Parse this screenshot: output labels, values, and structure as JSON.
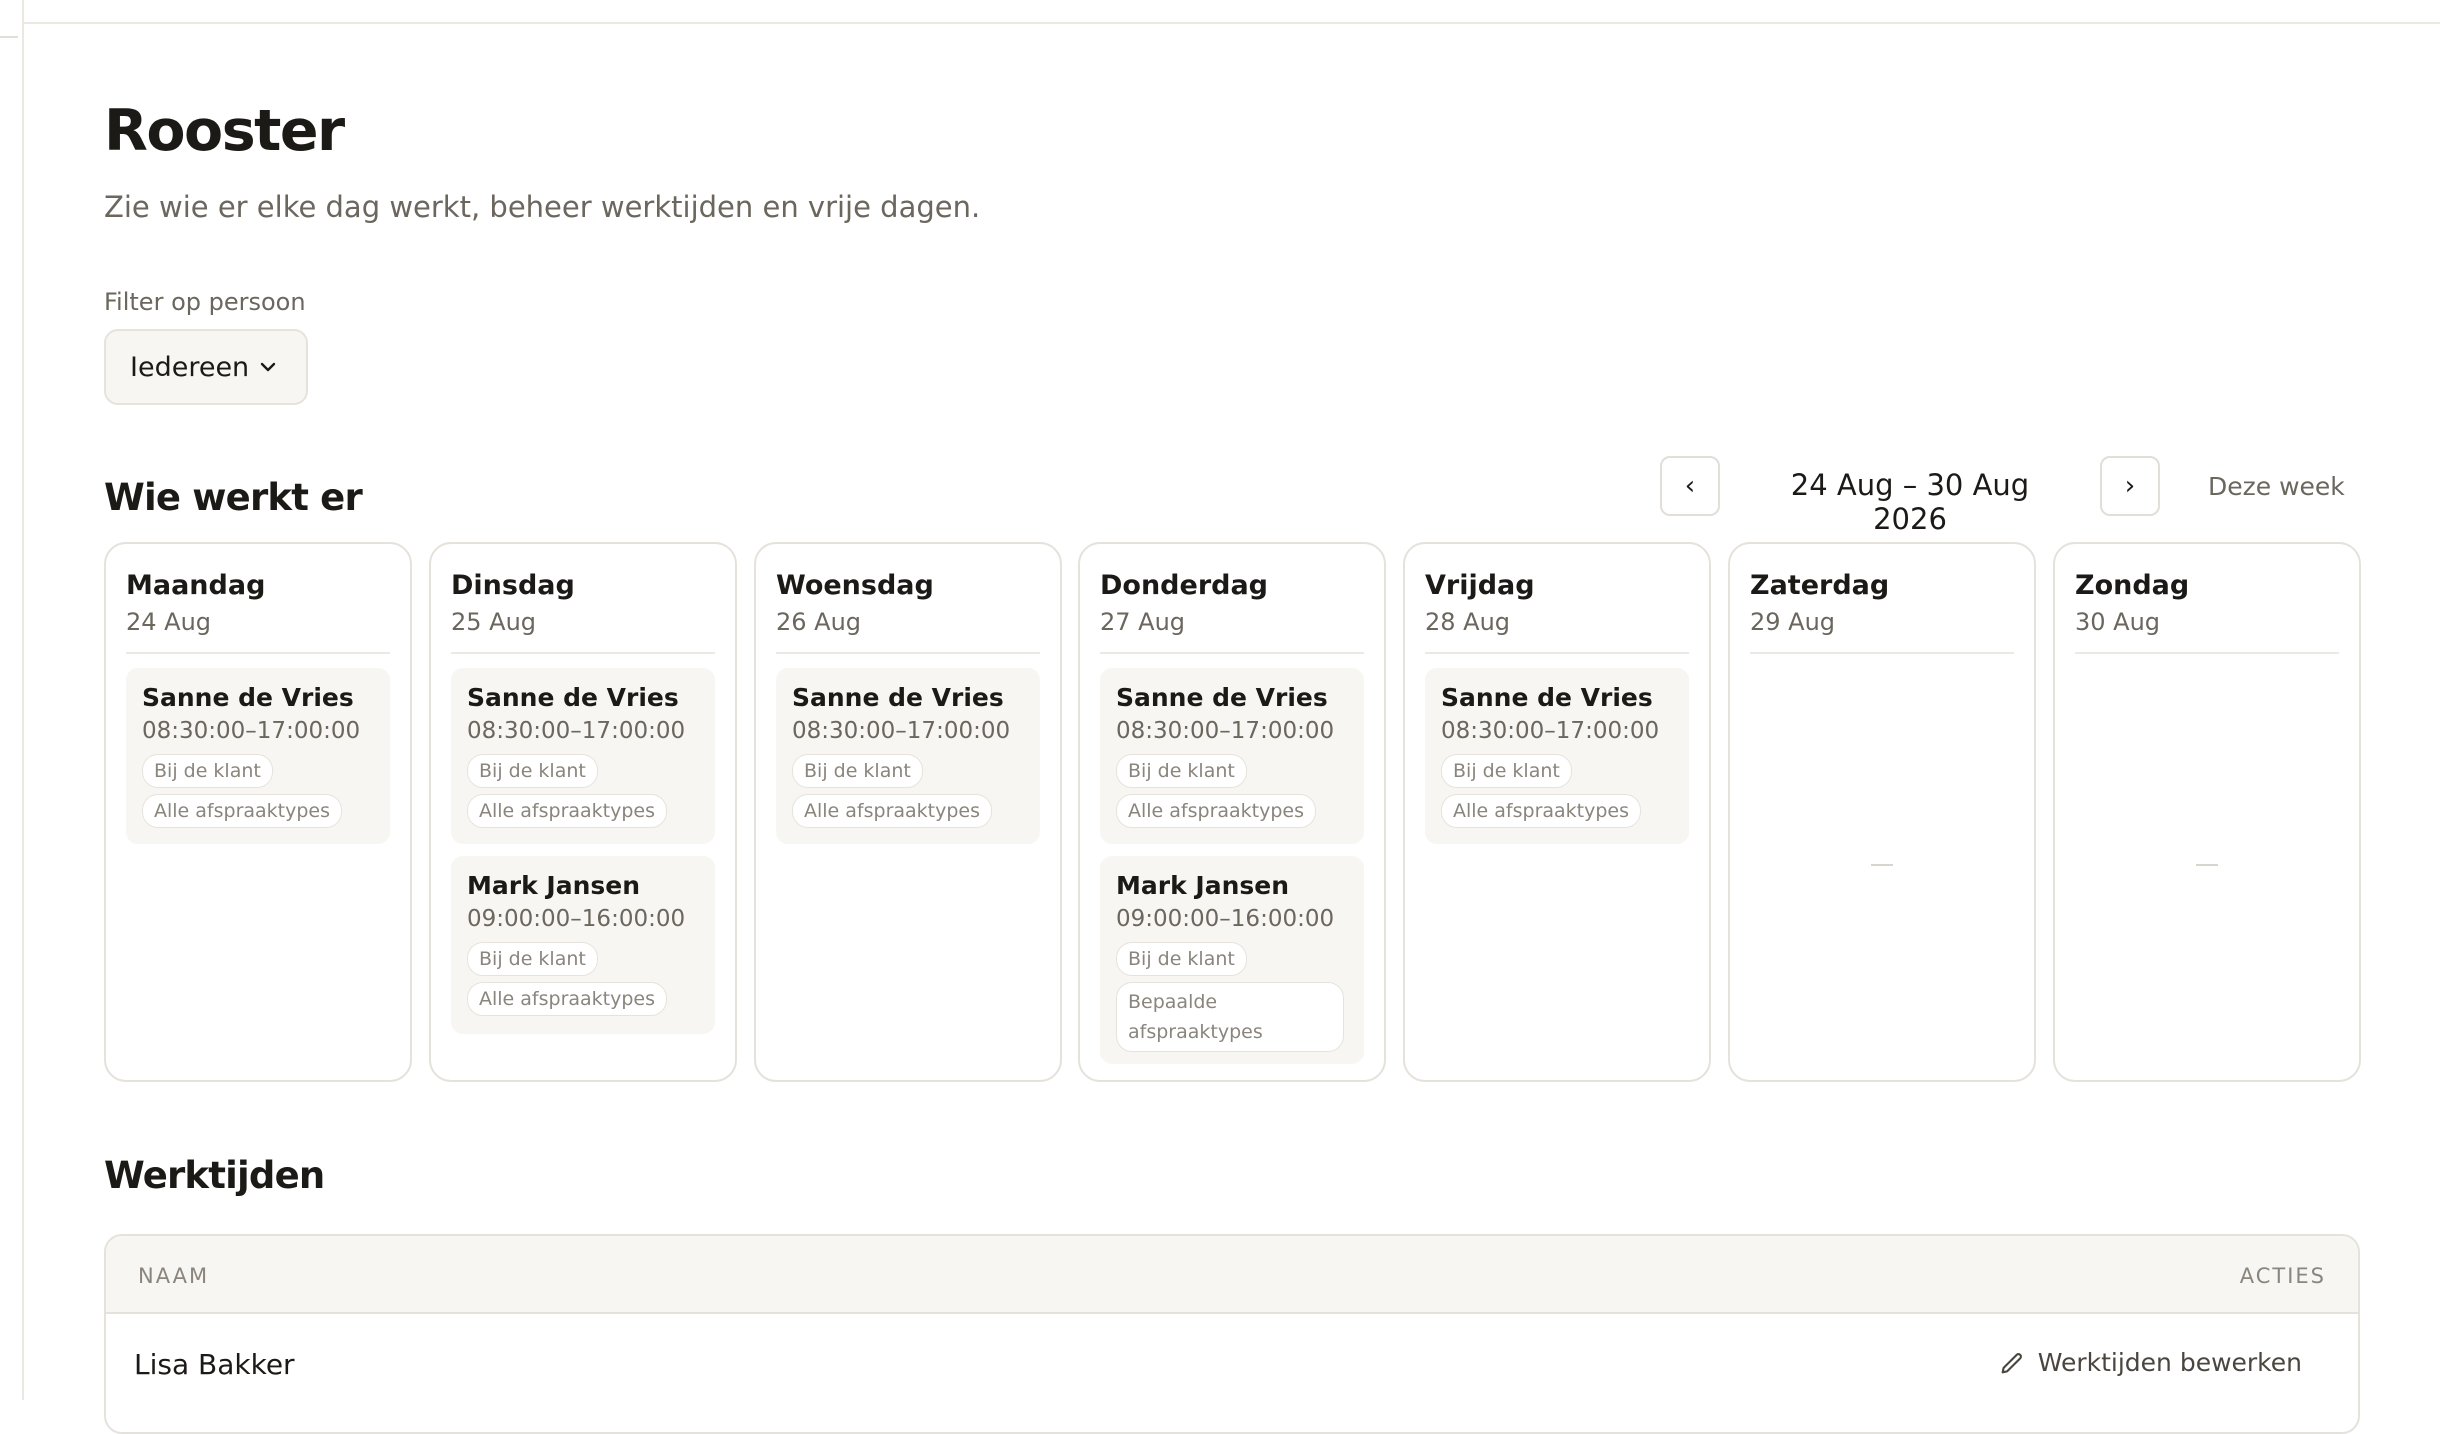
{
  "page": {
    "title": "Rooster",
    "subtitle": "Zie wie er elke dag werkt, beheer werktijden en vrije dagen."
  },
  "filter": {
    "label": "Filter op persoon",
    "selected": "Iedereen",
    "icon": "chevron-down-icon"
  },
  "schedule": {
    "title": "Wie werkt er",
    "prev_label": "‹",
    "next_label": "›",
    "range": "24 Aug – 30 Aug 2026",
    "this_week_label": "Deze week",
    "days": [
      {
        "name": "Maandag",
        "date": "24 Aug",
        "shifts": [
          {
            "name": "Sanne de Vries",
            "time": "08:30:00–17:00:00",
            "location": "Bij de klant",
            "types": "Alle afspraaktypes"
          }
        ]
      },
      {
        "name": "Dinsdag",
        "date": "25 Aug",
        "shifts": [
          {
            "name": "Sanne de Vries",
            "time": "08:30:00–17:00:00",
            "location": "Bij de klant",
            "types": "Alle afspraaktypes"
          },
          {
            "name": "Mark Jansen",
            "time": "09:00:00–16:00:00",
            "location": "Bij de klant",
            "types": "Alle afspraaktypes"
          }
        ]
      },
      {
        "name": "Woensdag",
        "date": "26 Aug",
        "shifts": [
          {
            "name": "Sanne de Vries",
            "time": "08:30:00–17:00:00",
            "location": "Bij de klant",
            "types": "Alle afspraaktypes"
          }
        ]
      },
      {
        "name": "Donderdag",
        "date": "27 Aug",
        "shifts": [
          {
            "name": "Sanne de Vries",
            "time": "08:30:00–17:00:00",
            "location": "Bij de klant",
            "types": "Alle afspraaktypes"
          },
          {
            "name": "Mark Jansen",
            "time": "09:00:00–16:00:00",
            "location": "Bij de klant",
            "types": "Bepaalde afspraaktypes"
          }
        ]
      },
      {
        "name": "Vrijdag",
        "date": "28 Aug",
        "shifts": [
          {
            "name": "Sanne de Vries",
            "time": "08:30:00–17:00:00",
            "location": "Bij de klant",
            "types": "Alle afspraaktypes"
          }
        ]
      },
      {
        "name": "Zaterdag",
        "date": "29 Aug",
        "shifts": []
      },
      {
        "name": "Zondag",
        "date": "30 Aug",
        "shifts": []
      }
    ]
  },
  "working_hours": {
    "title": "Werktijden",
    "columns": [
      "NAAM",
      "ACTIES"
    ],
    "rows": [
      {
        "name": "Lisa Bakker",
        "action": "Werktijden bewerken",
        "action_icon": "pencil-icon"
      }
    ]
  },
  "colors": {
    "text": "#1c1a17",
    "muted": "#6b665e",
    "border": "#e5e1db",
    "surface": "#f8f6f2"
  }
}
